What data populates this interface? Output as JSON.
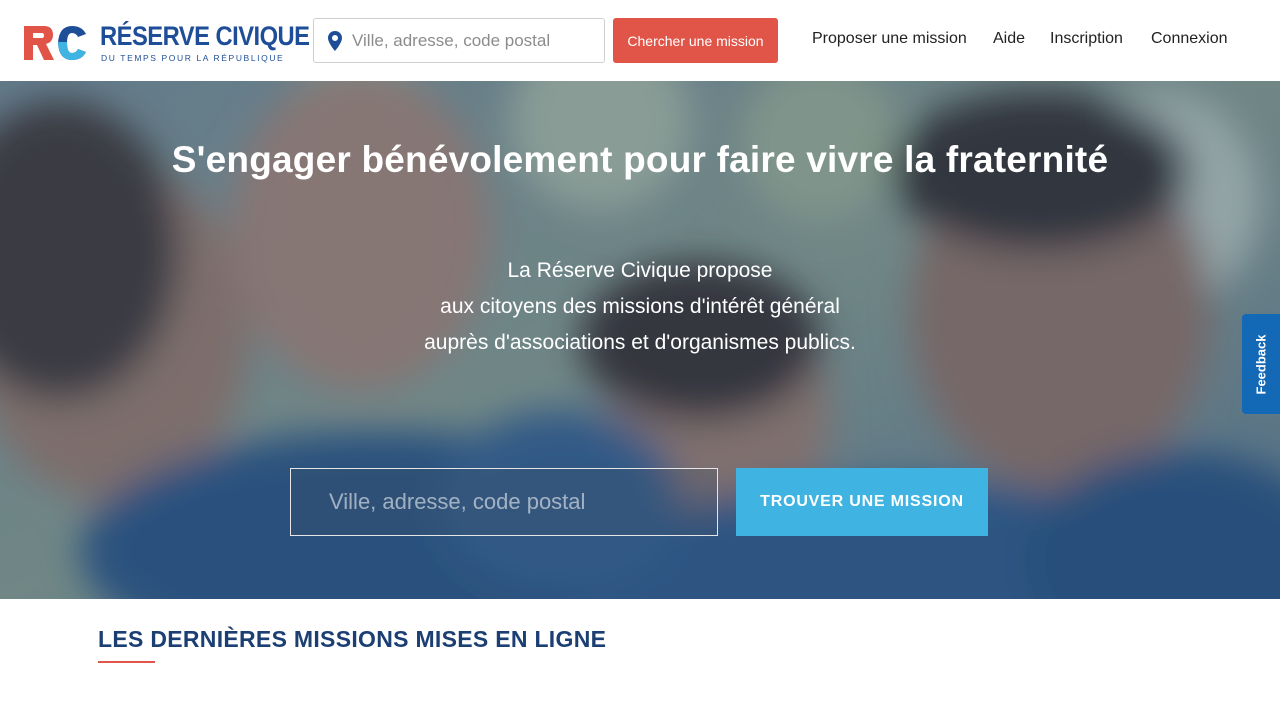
{
  "header": {
    "logo": {
      "mark": "RC",
      "title": "RÉSERVE CIVIQUE",
      "subtitle": "DU TEMPS POUR LA RÉPUBLIQUE"
    },
    "search": {
      "placeholder": "Ville, adresse, code postal",
      "value": "",
      "icon": "map-pin-icon"
    },
    "search_button": "Chercher une mission",
    "nav": [
      {
        "label": "Proposer une mission"
      },
      {
        "label": "Aide"
      },
      {
        "label": "Inscription"
      },
      {
        "label": "Connexion"
      }
    ]
  },
  "hero": {
    "title": "S'engager bénévolement pour faire vivre la fraternité",
    "lines": [
      "La Réserve Civique propose",
      "aux citoyens des missions d'intérêt général",
      "auprès d'associations et d'organismes publics."
    ],
    "search_placeholder": "Ville, adresse, code postal",
    "search_value": "",
    "find_button": "TROUVER UNE MISSION"
  },
  "feedback": {
    "label": "Feedback"
  },
  "section": {
    "title": "LES DERNIÈRES MISSIONS MISES EN LIGNE"
  },
  "colors": {
    "brand_blue": "#1f4e99",
    "brand_red": "#e05548",
    "accent_cyan": "#3fb3e1",
    "feedback_blue": "#1369b6",
    "section_title": "#1b3f72"
  }
}
